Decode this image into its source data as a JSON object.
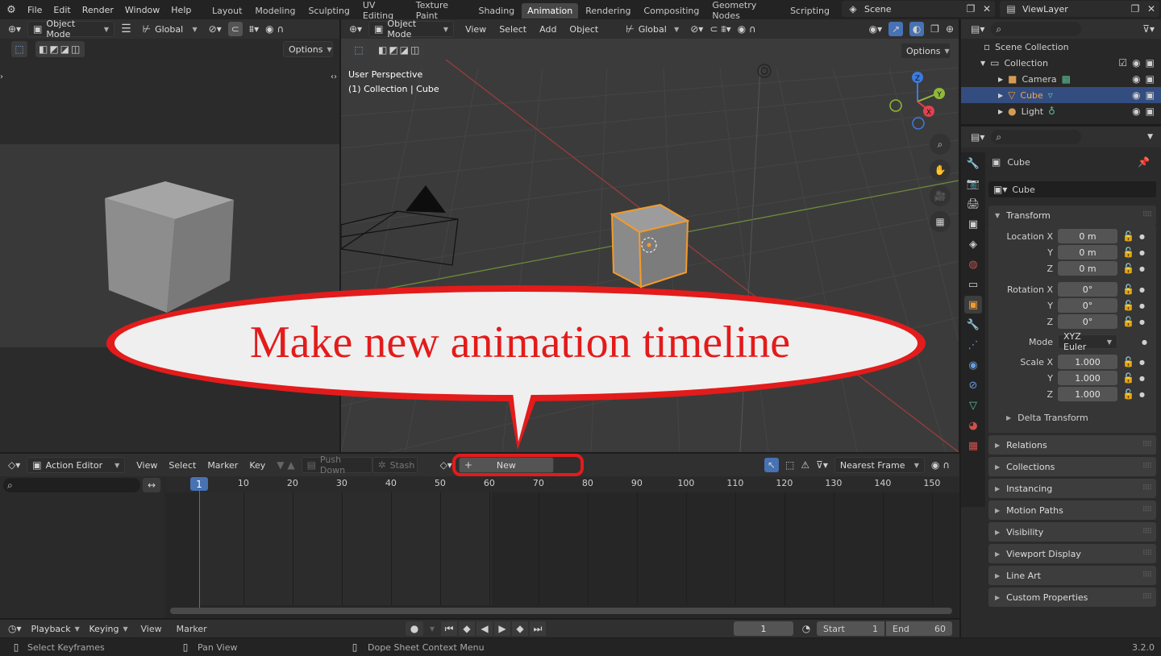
{
  "top_menu": {
    "file": "File",
    "edit": "Edit",
    "render": "Render",
    "window": "Window",
    "help": "Help"
  },
  "workspaces": [
    "Layout",
    "Modeling",
    "Sculpting",
    "UV Editing",
    "Texture Paint",
    "Shading",
    "Animation",
    "Rendering",
    "Compositing",
    "Geometry Nodes",
    "Scripting"
  ],
  "active_workspace": "Animation",
  "scene": {
    "label": "Scene"
  },
  "view_layer": {
    "label": "ViewLayer"
  },
  "left_viewport": {
    "mode": "Object Mode",
    "orientation": "Global",
    "options": "Options"
  },
  "main_viewport": {
    "mode": "Object Mode",
    "menu": [
      "View",
      "Select",
      "Add",
      "Object"
    ],
    "orientation": "Global",
    "options": "Options",
    "overlay_title": "User Perspective",
    "overlay_subtitle": "(1) Collection | Cube"
  },
  "outliner": {
    "scene_collection": "Scene Collection",
    "items": [
      {
        "label": "Collection"
      },
      {
        "label": "Camera"
      },
      {
        "label": "Cube"
      },
      {
        "label": "Light"
      }
    ]
  },
  "properties": {
    "object_name": "Cube",
    "data_name": "Cube",
    "transform_header": "Transform",
    "location": {
      "label": "Location X",
      "x": "0 m",
      "y": "0 m",
      "z": "0 m"
    },
    "rotation": {
      "label": "Rotation X",
      "x": "0°",
      "y": "0°",
      "z": "0°"
    },
    "mode_label": "Mode",
    "mode_value": "XYZ Euler",
    "scale": {
      "label": "Scale X",
      "x": "1.000",
      "y": "1.000",
      "z": "1.000"
    },
    "axis_y": "Y",
    "axis_z": "Z",
    "delta": "Delta Transform",
    "panels": [
      "Relations",
      "Collections",
      "Instancing",
      "Motion Paths",
      "Visibility",
      "Viewport Display",
      "Line Art",
      "Custom Properties"
    ]
  },
  "action_editor": {
    "mode": "Action Editor",
    "menu": [
      "View",
      "Select",
      "Marker",
      "Key"
    ],
    "push_down": "Push Down",
    "stash": "Stash",
    "new": "New",
    "snap": "Nearest Frame",
    "frames": [
      "1",
      "10",
      "20",
      "30",
      "40",
      "50",
      "60",
      "70",
      "80",
      "90",
      "100",
      "110",
      "120",
      "130",
      "140",
      "150"
    ]
  },
  "callout": {
    "text": "Make new animation timeline"
  },
  "timeline": {
    "playback": "Playback",
    "keying": "Keying",
    "view": "View",
    "marker": "Marker",
    "current_frame": "1",
    "start_label": "Start",
    "start": "1",
    "end_label": "End",
    "end": "60"
  },
  "status": {
    "select": "Select Keyframes",
    "pan": "Pan View",
    "context": "Dope Sheet Context Menu",
    "version": "3.2.0"
  },
  "colors": {
    "accent": "#4772b3",
    "active_outline": "#f29b2c",
    "callout_red": "#e31b1b"
  }
}
